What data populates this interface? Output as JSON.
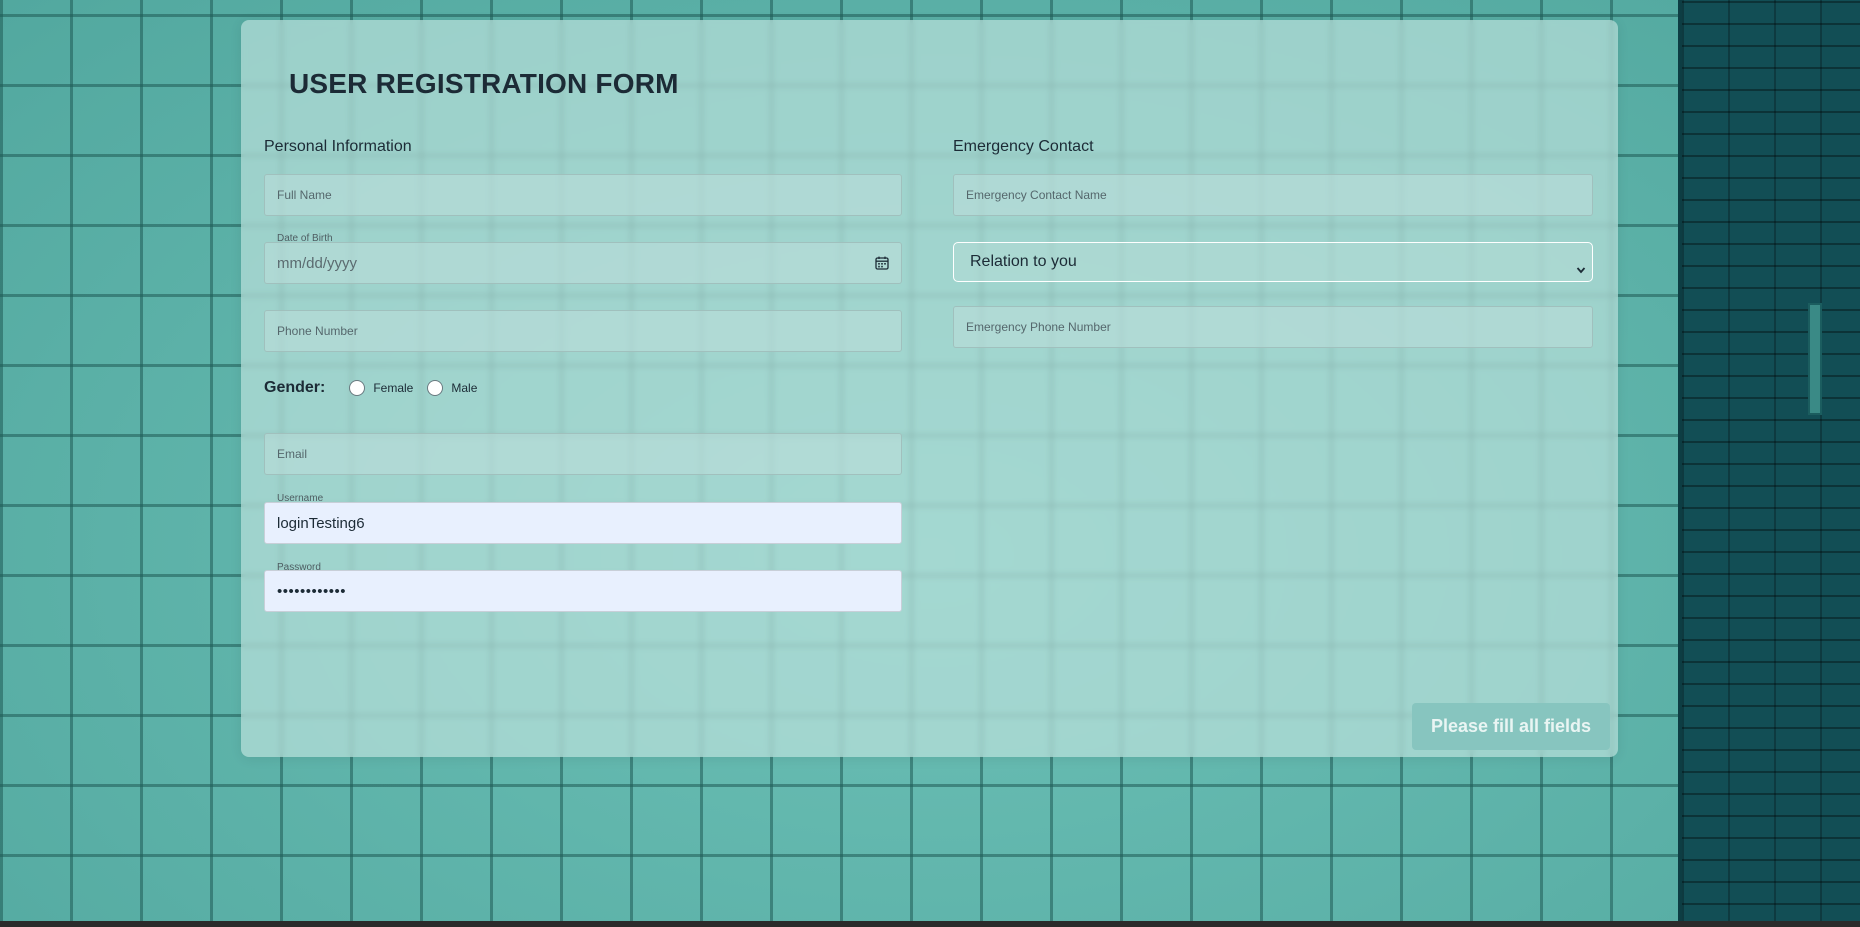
{
  "form": {
    "title": "USER REGISTRATION FORM",
    "personal": {
      "section_title": "Personal Information",
      "full_name_placeholder": "Full Name",
      "dob_label": "Date of Birth",
      "dob_placeholder": "mm/dd/yyyy",
      "phone_placeholder": "Phone Number",
      "gender_label": "Gender:",
      "gender_options": [
        "Female",
        "Male"
      ],
      "email_placeholder": "Email",
      "username_label": "Username",
      "username_value": "loginTesting6",
      "password_label": "Password",
      "password_value": "••••••••••••"
    },
    "emergency": {
      "section_title": "Emergency Contact",
      "contact_name_placeholder": "Emergency Contact Name",
      "relation_value": "Relation to you",
      "phone_placeholder": "Emergency Phone Number"
    },
    "submit_label": "Please fill all fields"
  },
  "icons": {
    "calendar": "calendar-icon",
    "chevron": "chevron-down-icon"
  },
  "colors": {
    "submit_bg": "#87c5bf",
    "autofill_bg": "#e8f0fe",
    "title_text": "#1c2b36"
  }
}
